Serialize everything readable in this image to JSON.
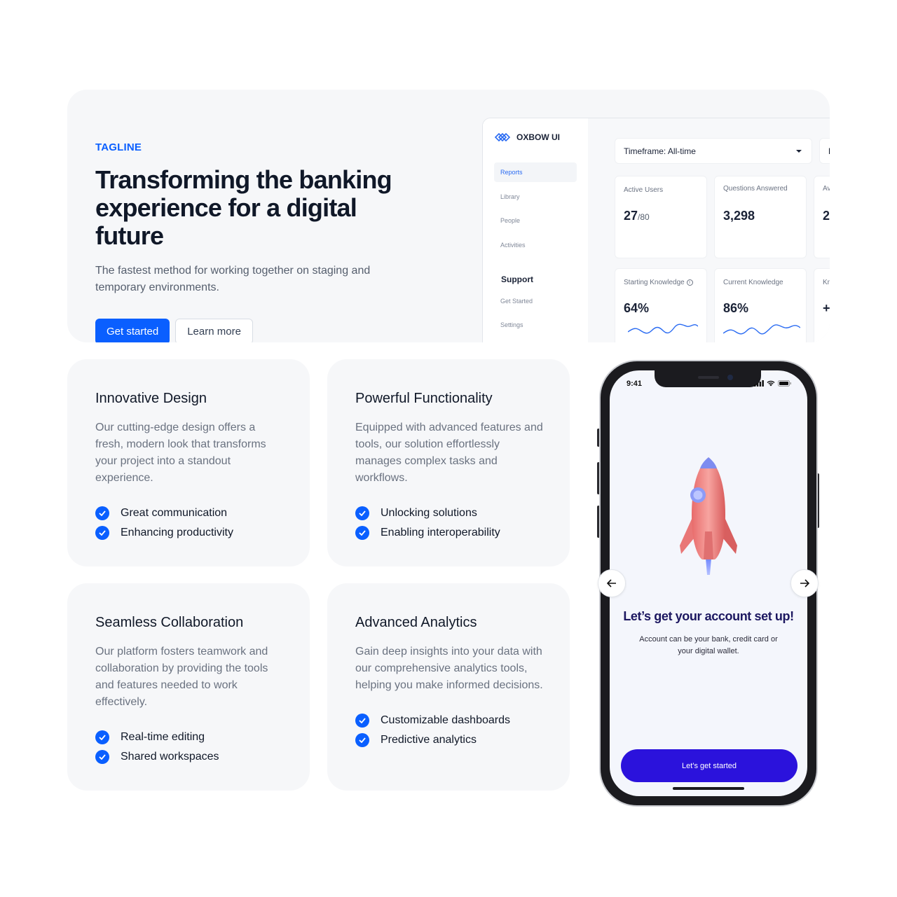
{
  "hero": {
    "tagline": "TAGLINE",
    "title": "Transforming the banking experience for a digital future",
    "subtitle": "The fastest method for working together on staging and temporary environments.",
    "primary_button": "Get started",
    "secondary_button": "Learn more"
  },
  "dashboard": {
    "brand": "OXBOW UI",
    "nav": [
      "Reports",
      "Library",
      "People",
      "Activities"
    ],
    "support_heading": "Support",
    "support_nav": [
      "Get Started",
      "Settings"
    ],
    "timeframe": "Timeframe: All-time",
    "timeframe2_partial": "F",
    "stats": [
      {
        "label": "Active Users",
        "value": "27",
        "suffix": "/80"
      },
      {
        "label": "Questions Answered",
        "value": "3,298",
        "suffix": ""
      },
      {
        "label": "Av",
        "value": "2",
        "suffix": ""
      },
      {
        "label": "Starting Knowledge",
        "value": "64%",
        "suffix": ""
      },
      {
        "label": "Current Knowledge",
        "value": "86%",
        "suffix": ""
      },
      {
        "label": "Kn",
        "value": "+",
        "suffix": ""
      }
    ]
  },
  "cards": [
    {
      "title": "Innovative Design",
      "desc": "Our cutting-edge design offers a fresh, modern look that transforms your project into a standout experience.",
      "items": [
        "Great communication",
        "Enhancing productivity"
      ]
    },
    {
      "title": "Powerful Functionality",
      "desc": "Equipped with advanced features and tools, our solution effortlessly manages complex tasks and workflows.",
      "items": [
        "Unlocking solutions",
        "Enabling interoperability"
      ]
    },
    {
      "title": "Seamless Collaboration",
      "desc": "Our platform fosters teamwork and collaboration by providing the tools and features needed to work effectively.",
      "items": [
        "Real-time editing",
        "Shared workspaces"
      ]
    },
    {
      "title": "Advanced Analytics",
      "desc": "Gain deep insights into your data with our comprehensive analytics tools, helping you make informed decisions.",
      "items": [
        "Customizable dashboards",
        "Predictive analytics"
      ]
    }
  ],
  "phone": {
    "time": "9:41",
    "title": "Let’s get your account set up!",
    "subtitle": "Account can be your bank, credit card or your digital wallet.",
    "button": "Let’s get started"
  },
  "colors": {
    "accent": "#0a5fff",
    "phone_button": "#2b12dc",
    "card_bg": "#f6f7f9"
  }
}
